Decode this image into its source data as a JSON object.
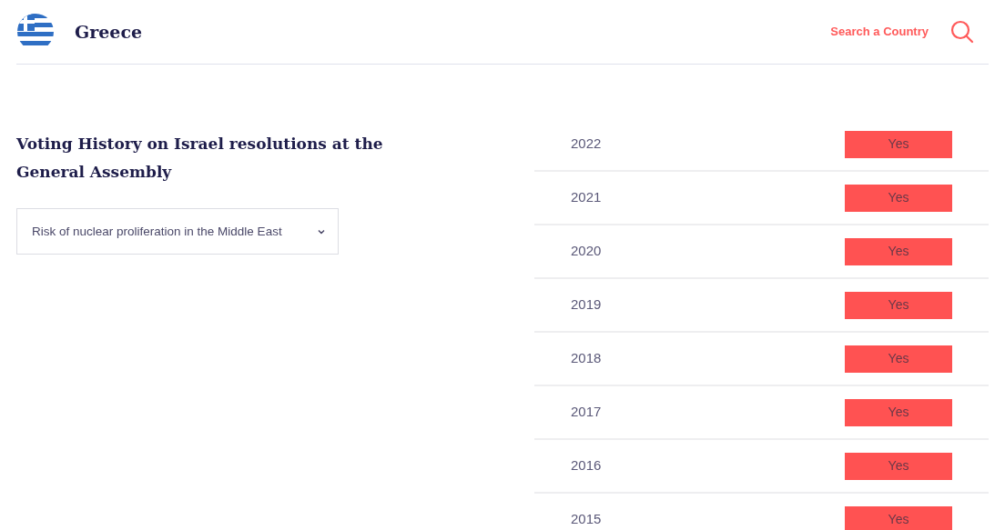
{
  "header": {
    "country": "Greece",
    "search_label": "Search a Country"
  },
  "section": {
    "title": "Voting History on Israel resolutions at the General Assembly",
    "dropdown": {
      "value": "Risk of nuclear proliferation in the Middle East"
    }
  },
  "votes": [
    {
      "year": "2022",
      "vote": "Yes"
    },
    {
      "year": "2021",
      "vote": "Yes"
    },
    {
      "year": "2020",
      "vote": "Yes"
    },
    {
      "year": "2019",
      "vote": "Yes"
    },
    {
      "year": "2018",
      "vote": "Yes"
    },
    {
      "year": "2017",
      "vote": "Yes"
    },
    {
      "year": "2016",
      "vote": "Yes"
    },
    {
      "year": "2015",
      "vote": "Yes"
    }
  ]
}
